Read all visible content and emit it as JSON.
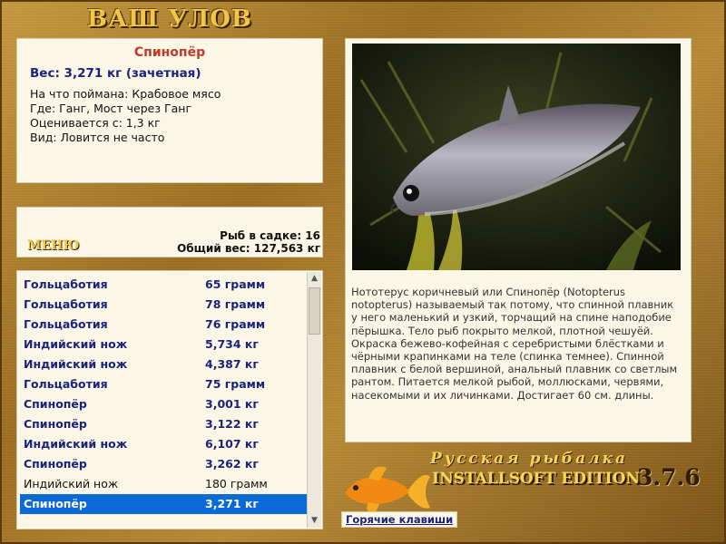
{
  "header": {
    "title": "ВАШ УЛОВ"
  },
  "catch": {
    "fish_name": "Спинопёр",
    "weight": "Вес: 3,271 кг (зачетная)",
    "bait": "На что поймана: Крабовое мясо",
    "location": "Где: Ганг, Мост через Ганг",
    "value": "Оценивается с: 1,3 кг",
    "rarity": "Вид: Ловится не часто"
  },
  "summary": {
    "menu_label": "МЕНЮ",
    "fish_count": "Рыб в садке: 16",
    "total_weight": "Общий вес: 127,563 кг"
  },
  "catch_list": [
    {
      "name": "Гольцаботия",
      "weight": "65 грамм",
      "style": "bold"
    },
    {
      "name": "Гольцаботия",
      "weight": "78 грамм",
      "style": "bold"
    },
    {
      "name": "Гольцаботия",
      "weight": "76 грамм",
      "style": "bold"
    },
    {
      "name": "Индийский нож",
      "weight": "5,734 кг",
      "style": "bold"
    },
    {
      "name": "Индийский нож",
      "weight": "4,387 кг",
      "style": "bold"
    },
    {
      "name": "Гольцаботия",
      "weight": "75 грамм",
      "style": "bold"
    },
    {
      "name": "Спинопёр",
      "weight": "3,001 кг",
      "style": "bold"
    },
    {
      "name": "Спинопёр",
      "weight": "3,122 кг",
      "style": "bold"
    },
    {
      "name": "Индийский нож",
      "weight": "6,107 кг",
      "style": "bold"
    },
    {
      "name": "Спинопёр",
      "weight": "3,262 кг",
      "style": "bold"
    },
    {
      "name": "Индийский нож",
      "weight": "180 грамм",
      "style": "plain"
    },
    {
      "name": "Спинопёр",
      "weight": "3,271 кг",
      "style": "sel"
    }
  ],
  "description": "Нототерус коричневый или Спинопёр (Notopterus notopterus) называемый так потому, что спинной плавник у него маленький и узкий, торчащий на спине наподобие пёрышка. Тело рыб покрыто мелкой, плотной чешуёй. Окраска бежево-кофейная с серебристыми блёстками и чёрными крапинками на теле (спинка темнее). Спинной плавник с белой вершиной, анальный плавник со светлым рантом. Питается мелкой рыбой, моллюсками, червями, насекомыми и их личинками. Достигает 60 см. длины.",
  "footer": {
    "brand": "Русская рыбалка",
    "edition": "INSTALLSOFT EDITION",
    "version": "3.7.6",
    "hotkeys": "Горячие клавиши"
  },
  "colors": {
    "accent_blue": "#1a237e",
    "selection": "#0a6ad8",
    "fish_name_red": "#c0392b",
    "gold_text": "#f0c64a"
  },
  "icons": {
    "logo": "goldfish-icon",
    "scroll_up": "arrow-up-icon",
    "scroll_down": "arrow-down-icon"
  }
}
